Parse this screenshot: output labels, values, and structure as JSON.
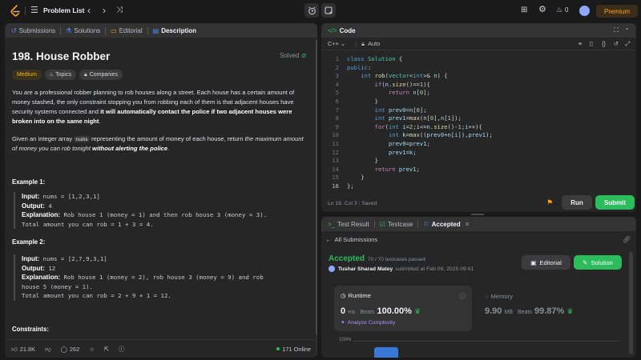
{
  "topbar": {
    "problem_list": "Problem List",
    "coins": "0",
    "premium": "Premium"
  },
  "left": {
    "tabs": [
      "Submissions",
      "Solutions",
      "Editorial",
      "Description"
    ],
    "title": "198. House Robber",
    "solved": "Solved",
    "tags": [
      "Medium",
      "Topics",
      "Companies"
    ],
    "desc_p1_a": "You are a professional robber planning to rob houses along a street. Each house has a certain amount of money stashed, the only constraint stopping you from robbing each of them is that adjacent houses have security systems connected and ",
    "desc_p1_b": "it will automatically contact the police if two adjacent houses were broken into on the same night",
    "desc_p1_c": ".",
    "desc_p2_a": "Given an integer array ",
    "desc_p2_code": "nums",
    "desc_p2_b": " representing the amount of money of each house, return ",
    "desc_p2_i": "the maximum amount of money you can rob tonight ",
    "desc_p2_bold": "without alerting the police",
    "desc_p2_c": ".",
    "examples": [
      {
        "title": "Example 1:",
        "input_label": "Input:",
        "input": " nums = [1,2,3,1]",
        "output_label": "Output:",
        "output": " 4",
        "expl_label": "Explanation:",
        "expl1": " Rob house 1 (money = 1) and then rob house 3 (money = 3).",
        "expl2": "Total amount you can rob = 1 + 3 = 4."
      },
      {
        "title": "Example 2:",
        "input_label": "Input:",
        "input": " nums = [2,7,9,3,1]",
        "output_label": "Output:",
        "output": " 12",
        "expl_label": "Explanation:",
        "expl1": " Rob house 1 (money = 2), rob house 3 (money = 9) and rob",
        "expl2": "house 5 (money = 1).",
        "expl3": "Total amount you can rob = 2 + 9 + 1 = 12."
      }
    ],
    "constraints": "Constraints:",
    "footer": {
      "likes": "21.8K",
      "comments": "262",
      "online": "171 Online"
    }
  },
  "code": {
    "title": "Code",
    "language": "C++",
    "mode": "Auto",
    "status": "Ln 16, Col 3",
    "saved": "Saved",
    "run": "Run",
    "submit": "Submit",
    "line_numbers": [
      "1",
      "2",
      "3",
      "4",
      "5",
      "6",
      "7",
      "8",
      "9",
      "10",
      "11",
      "12",
      "13",
      "14",
      "15",
      "16"
    ]
  },
  "result": {
    "tabs": [
      "Test Result",
      "Testcase",
      "Accepted"
    ],
    "back": "All Submissions",
    "status": "Accepted",
    "passed": "70 / 70 testcases passed",
    "user": "Tushar Sharad Matey",
    "submitted": "submitted at Feb 09, 2025 09:41",
    "editorial": "Editorial",
    "solution": "Solution",
    "runtime_label": "Runtime",
    "runtime_value": "0",
    "runtime_unit": "ms",
    "beats_label": "Beats",
    "runtime_beats": "100.00%",
    "analyze": "Analyze Complexity",
    "memory_label": "Memory",
    "memory_value": "9.90",
    "memory_unit": "MB",
    "memory_beats": "99.87%",
    "chart_tick": "100%"
  },
  "colors": {
    "accent_green": "#2cbb5d",
    "medium_yellow": "#ffb800",
    "premium_orange": "#ffa116",
    "panel": "#262626"
  }
}
